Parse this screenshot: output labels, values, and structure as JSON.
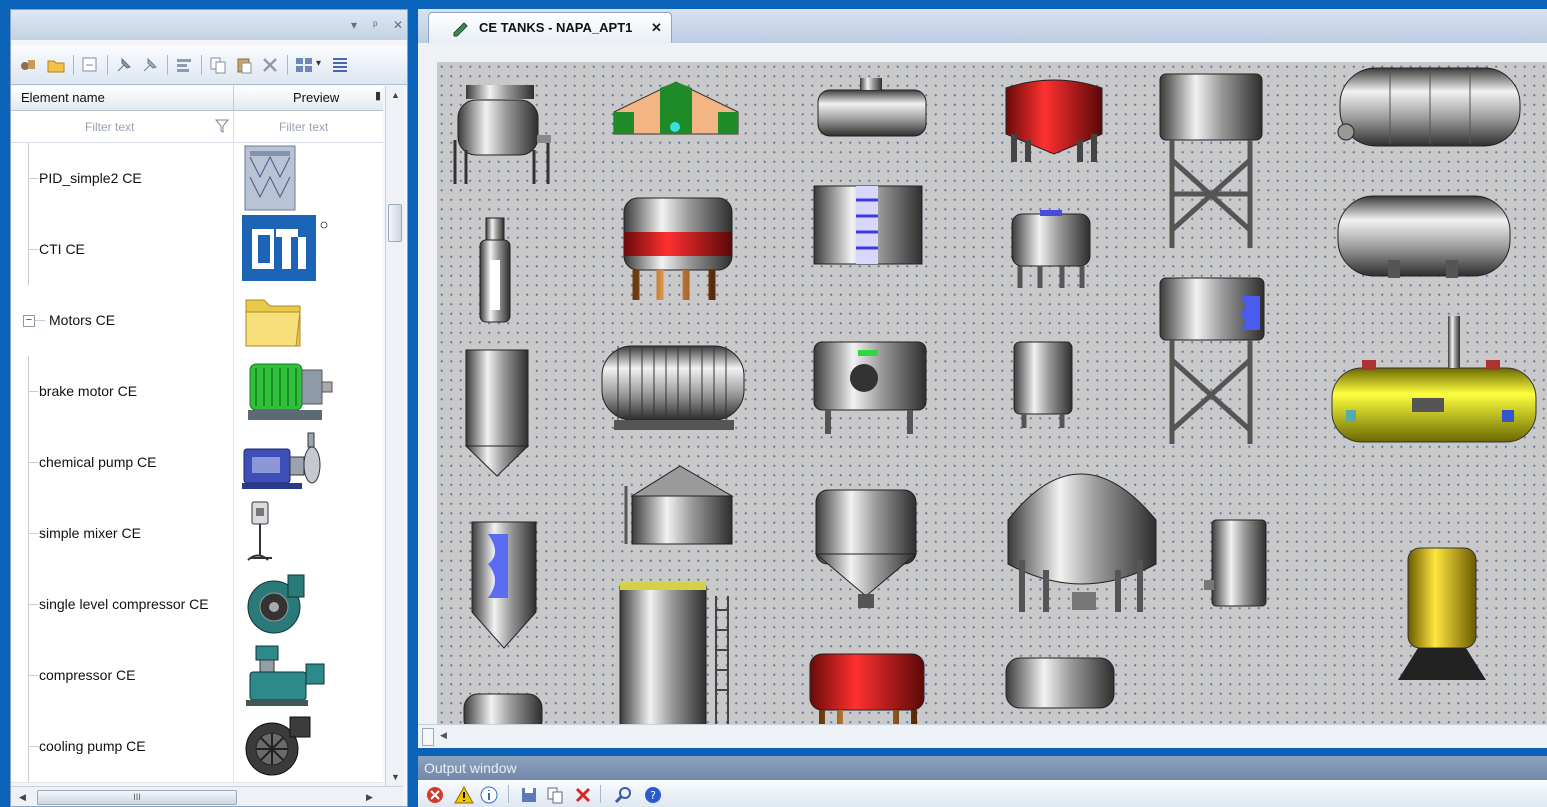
{
  "left_panel": {
    "toolbar_icons": [
      "open-element-icon",
      "open-folder-icon",
      "new-element-icon",
      "pin-icon",
      "unpin-icon",
      "properties-icon",
      "copy-icon",
      "paste-icon",
      "delete-icon",
      "view-mode-icon",
      "columns-icon"
    ],
    "columns": {
      "name": "Element name",
      "preview": "Preview"
    },
    "filter": {
      "name_placeholder": "Filter text",
      "preview_placeholder": "Filter text"
    },
    "items": [
      {
        "label": "PID_simple2 CE",
        "preview": "pid-diagram-thumbnail"
      },
      {
        "label": "CTI CE",
        "preview": "cti-logo-thumbnail"
      },
      {
        "label": "Motors CE",
        "preview": "folder-icon",
        "collapse_toggle": "−"
      },
      {
        "label": "brake motor CE",
        "preview": "brake-motor-thumbnail"
      },
      {
        "label": "chemical pump CE",
        "preview": "chemical-pump-thumbnail"
      },
      {
        "label": "simple mixer CE",
        "preview": "mixer-thumbnail"
      },
      {
        "label": "single level compressor CE",
        "preview": "compressor-thumbnail"
      },
      {
        "label": "compressor CE",
        "preview": "compressor-thumbnail"
      },
      {
        "label": "cooling pump CE",
        "preview": "cooling-pump-thumbnail"
      }
    ],
    "title_buttons": {
      "dropdown": "▾",
      "pin": "ᵖ",
      "close": "✕"
    },
    "hscroll_grip": "III"
  },
  "document_tab": {
    "title": "CE TANKS - NAPA_APT1",
    "close": "✕"
  },
  "output_window": {
    "title": "Output window",
    "toolbar_icons": [
      "error-icon",
      "warning-icon",
      "info-icon",
      "save-icon",
      "copy-icon",
      "clear-icon",
      "find-icon",
      "help-icon"
    ]
  },
  "colors": {
    "desktop_blue": "#0a63b8",
    "canvas_gray": "#c9c9c9",
    "tank_red": "#d0121b",
    "tank_yellow": "#e8e000",
    "motor_green": "#2fbf3a",
    "level_blue": "#4a5cf0"
  }
}
